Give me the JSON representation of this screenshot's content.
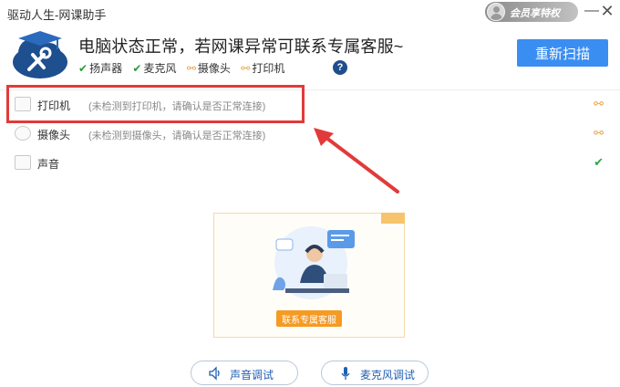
{
  "window": {
    "title": "驱动人生-网课助手",
    "member_label": "会员享特权",
    "minimize": "—",
    "close": "✕"
  },
  "header": {
    "headline": "电脑状态正常，若网课异常可联系专属客服~",
    "status_items": [
      {
        "label": "扬声器",
        "state": "ok"
      },
      {
        "label": "麦克风",
        "state": "ok"
      },
      {
        "label": "摄像头",
        "state": "broken"
      },
      {
        "label": "打印机",
        "state": "broken"
      }
    ],
    "ok_mark": "✔",
    "broken_mark": "⚯",
    "help_mark": "?",
    "rescan_label": "重新扫描"
  },
  "devices": [
    {
      "name": "打印机",
      "note": "(未检测到打印机，请确认是否正常连接)",
      "status_mark": "⚯",
      "icon": "printer-icon"
    },
    {
      "name": "摄像头",
      "note": "(未检测到摄像头，请确认是否正常连接)",
      "status_mark": "⚯",
      "icon": "camera-icon"
    },
    {
      "name": "声音",
      "note": "",
      "status_mark": "✔",
      "icon": "speaker-icon"
    }
  ],
  "promo": {
    "button_label": "联系专属客服"
  },
  "tests": {
    "sound_label": "声音调试",
    "mic_label": "麦克风调试"
  },
  "colors": {
    "primary": "#3a8ef2",
    "highlight": "#e23a3a",
    "ok": "#2aa845",
    "warn": "#eaa449",
    "promo_button": "#f59a23"
  }
}
